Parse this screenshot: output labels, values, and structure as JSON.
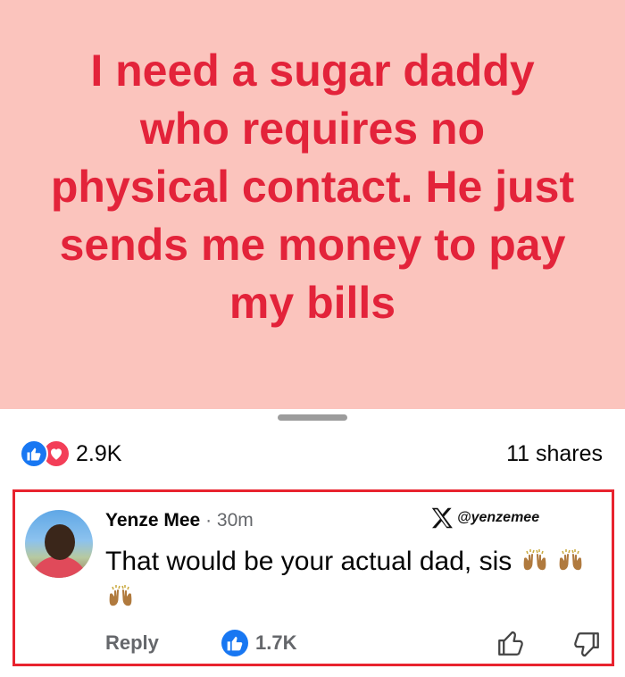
{
  "post": {
    "text": "I need a sugar daddy who requires no physical contact. He just sends me money to pay my bills",
    "background_color": "#fbc4bd",
    "text_color": "#e3233a"
  },
  "reactions": {
    "icons": [
      "like-icon",
      "love-icon"
    ],
    "count": "2.9K",
    "shares": "11 shares"
  },
  "comment": {
    "author": "Yenze Mee",
    "separator": "·",
    "time": "30m",
    "text": "That would be your actual dad, sis",
    "emoji": [
      "raising-hands-emoji",
      "raising-hands-emoji",
      "raising-hands-emoji"
    ],
    "watermark": "@yenzemee",
    "reply_label": "Reply",
    "like_count": "1.7K",
    "highlight_color": "#e8232e"
  }
}
